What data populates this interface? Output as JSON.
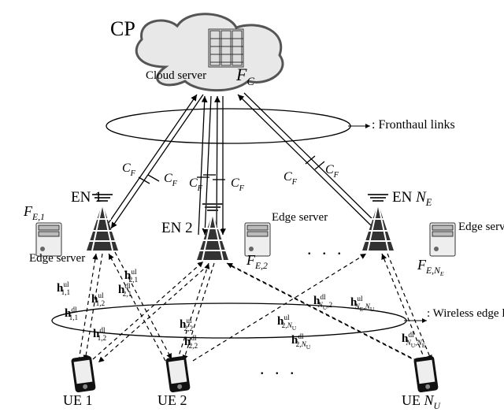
{
  "title": "CP",
  "cloud": {
    "label": "Cloud server",
    "cap": "F",
    "cap_sub": "C"
  },
  "fronthaul": {
    "caption": ": Fronthaul links",
    "cf": "C",
    "cf_sub": "F"
  },
  "wireless": {
    "caption": ": Wireless edge links"
  },
  "en1": {
    "name": "EN 1",
    "server": "Edge server",
    "F": "F",
    "F_sub": "E,1"
  },
  "en2": {
    "name": "EN 2",
    "server": "Edge server",
    "F": "F",
    "F_sub": "E,2"
  },
  "enN": {
    "name_prefix": "EN ",
    "name_var": "N",
    "name_var_sub": "E",
    "server": "Edge server",
    "F": "F",
    "F_sub_pre": "E,",
    "F_sub_var": "N",
    "F_sub_var_sub": "E"
  },
  "ue1": "UE 1",
  "ue2": "UE 2",
  "ueN_prefix": "UE ",
  "ueN_var": "N",
  "ueN_var_sub": "U",
  "dots": ". . .",
  "h": {
    "h11ul": {
      "t": "h",
      "s": "1,1",
      "p": "ul"
    },
    "h11dl": {
      "t": "h",
      "s": "1,1",
      "p": "dl"
    },
    "h12ul": {
      "t": "h",
      "s": "1,2",
      "p": "ul"
    },
    "h12dl": {
      "t": "h",
      "s": "1,2",
      "p": "dl"
    },
    "h21ul": {
      "t": "h",
      "s": "2,1",
      "p": "ul"
    },
    "h21dl": {
      "t": "h",
      "s": "2,1",
      "p": "dl"
    },
    "h22ul": {
      "t": "h",
      "s": "2,2",
      "p": "ul"
    },
    "h22dl": {
      "t": "h",
      "s": "2,2",
      "p": "dl"
    },
    "h2nu_ul": {
      "t": "h",
      "s": "2,N_U",
      "p": "ul"
    },
    "h2nu_dl": {
      "t": "h",
      "s": "2,N_U",
      "p": "dl"
    },
    "hnu2_dl": {
      "t": "h",
      "s": "N_U,2",
      "p": "dl"
    },
    "hne_nu_ul": {
      "t": "h",
      "s": "N_E,N_U",
      "p": "ul"
    },
    "hnu_ne_dl": {
      "t": "h",
      "s": "N_U,N_E",
      "p": "dl"
    }
  }
}
